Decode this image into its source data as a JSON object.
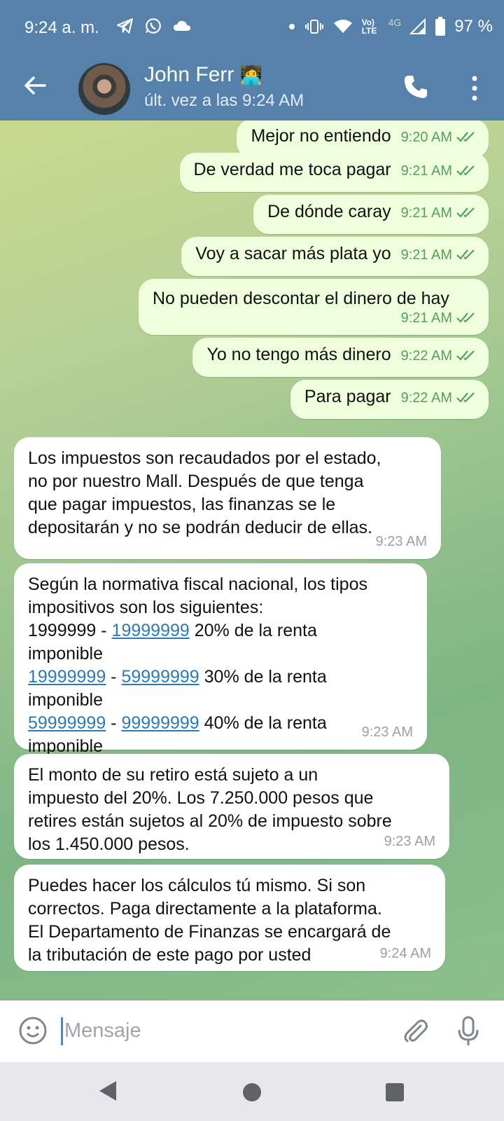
{
  "status": {
    "time": "9:24 a. m.",
    "battery": "97 %",
    "network": "4G",
    "volte": "Vo) LTE",
    "left_icons": [
      "telegram-icon",
      "whatsapp-icon",
      "cloud-icon"
    ],
    "right_icons": [
      "dot-icon",
      "vibrate-icon",
      "wifi-icon",
      "volte-icon",
      "signal-icon",
      "battery-icon"
    ]
  },
  "header": {
    "name": "John Ferr",
    "last_seen": "últ. vez a las 9:24 AM",
    "name_emoji": "🧑‍💻"
  },
  "messages_out": [
    {
      "text": "Mejor no entiendo",
      "time": "9:20 AM"
    },
    {
      "text": "De verdad me toca pagar",
      "time": "9:21 AM"
    },
    {
      "text": "De dónde caray",
      "time": "9:21 AM"
    },
    {
      "text": "Voy a sacar más plata yo",
      "time": "9:21 AM"
    },
    {
      "text": "No pueden descontar el dinero de hay",
      "time": "9:21 AM"
    },
    {
      "text": "Yo no tengo más dinero",
      "time": "9:22 AM"
    },
    {
      "text": "Para pagar",
      "time": "9:22 AM"
    }
  ],
  "messages_in": [
    {
      "lines": [
        "Los impuestos son recaudados por el estado,",
        "no por nuestro Mall. Después de que tenga",
        "que pagar impuestos, las finanzas se le",
        "depositarán y no se podrán deducir de ellas."
      ],
      "time": "9:23 AM"
    },
    {
      "line1": "Según la normativa fiscal nacional, los tipos",
      "line2": "impositivos son los siguientes:",
      "r1_a": "1999999",
      "r1_sep": " - ",
      "r1_b": "19999999",
      "r1_rest": " 20% de la renta",
      "r_imponible": "imponible",
      "r2_a": "19999999",
      "r2_sep": " - ",
      "r2_b": "59999999",
      "r2_rest": " 30% de la renta",
      "r3_a": "59999999",
      "r3_sep": " - ",
      "r3_b": "99999999",
      "r3_rest": " 40% de la renta",
      "time": "9:23 AM"
    },
    {
      "lines": [
        "El monto de su retiro está sujeto a un",
        "impuesto del 20%. Los 7.250.000 pesos que",
        "retires están sujetos al 20% de impuesto sobre",
        "los 1.450.000 pesos."
      ],
      "time": "9:23 AM"
    },
    {
      "lines": [
        "Puedes hacer los cálculos tú mismo. Si son",
        "correctos. Paga directamente a la plataforma.",
        "El Departamento de Finanzas se encargará de",
        "la tributación de este pago por usted"
      ],
      "time": "9:24 AM"
    }
  ],
  "input": {
    "placeholder": "Mensaje"
  },
  "colors": {
    "header": "#5581ab",
    "out_bubble": "#effedd",
    "in_bubble": "#ffffff",
    "tick": "#54a15a",
    "link": "#2a79b8"
  }
}
